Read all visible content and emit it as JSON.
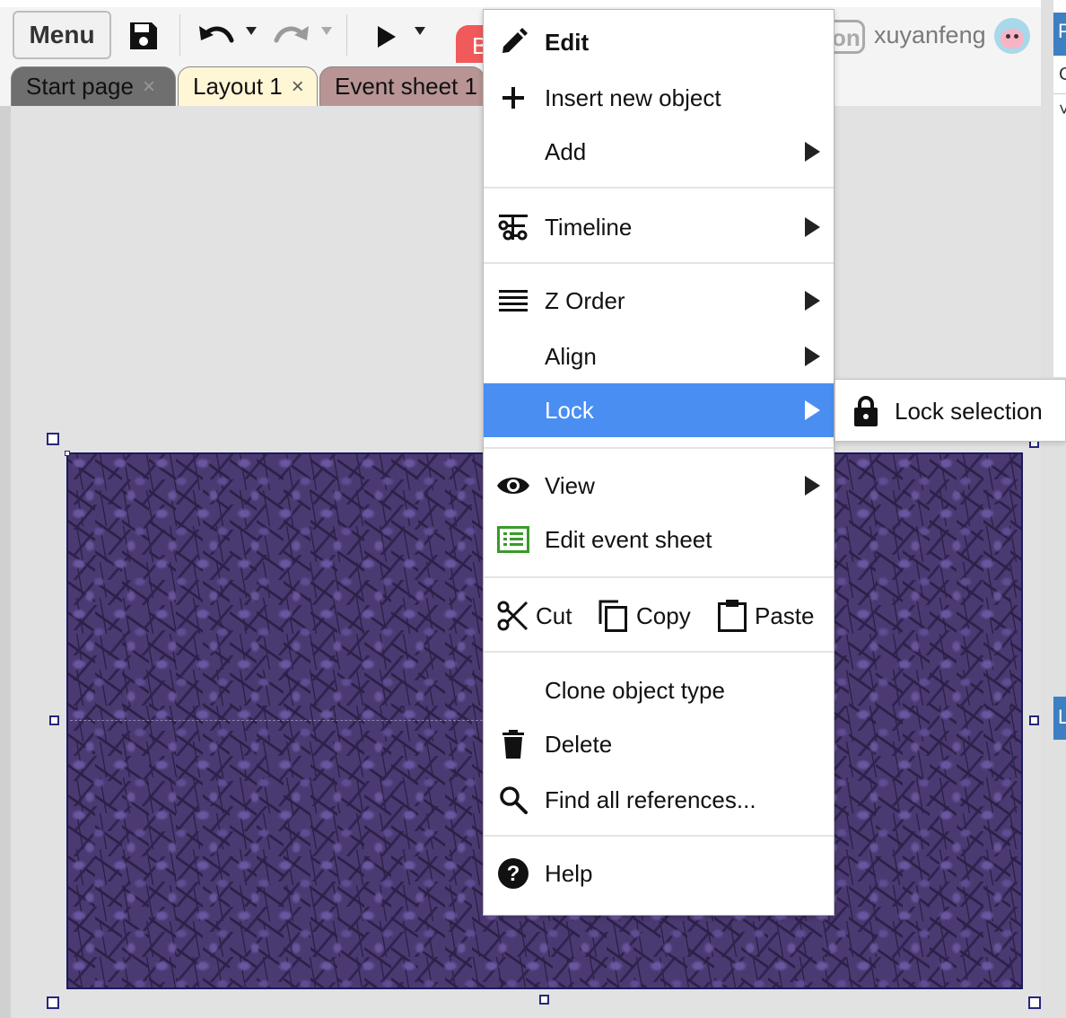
{
  "toolbar": {
    "menu_label": "Menu",
    "red_tab_letter": "B",
    "badge_text": "on",
    "username": "xuyanfeng"
  },
  "tabs": [
    {
      "label": "Start page",
      "close": "×"
    },
    {
      "label": "Layout 1",
      "close": "×"
    },
    {
      "label": "Event sheet 1",
      "close": ""
    }
  ],
  "context_menu": {
    "edit": "Edit",
    "insert_new_object": "Insert new object",
    "add": "Add",
    "timeline": "Timeline",
    "z_order": "Z Order",
    "align": "Align",
    "lock": "Lock",
    "view": "View",
    "edit_event_sheet": "Edit event sheet",
    "cut": "Cut",
    "copy": "Copy",
    "paste": "Paste",
    "clone_object_type": "Clone object type",
    "delete": "Delete",
    "find_all_references": "Find all references...",
    "help": "Help"
  },
  "submenu": {
    "lock_selection": "Lock selection"
  },
  "right_panel": {
    "tab1_letter": "P",
    "tab2_letter": "L",
    "row_char": "C",
    "row_chevron": "˅"
  },
  "colors": {
    "menu_highlight": "#4a8ef2",
    "edit_event_sheet_icon": "#3a9a2a",
    "red_tab": "#f05a5a",
    "panel_blue": "#3c7fc2",
    "tab_start_page": "#6f6f6f",
    "tab_layout": "#fff6d6",
    "tab_event_sheet": "#b89494"
  }
}
